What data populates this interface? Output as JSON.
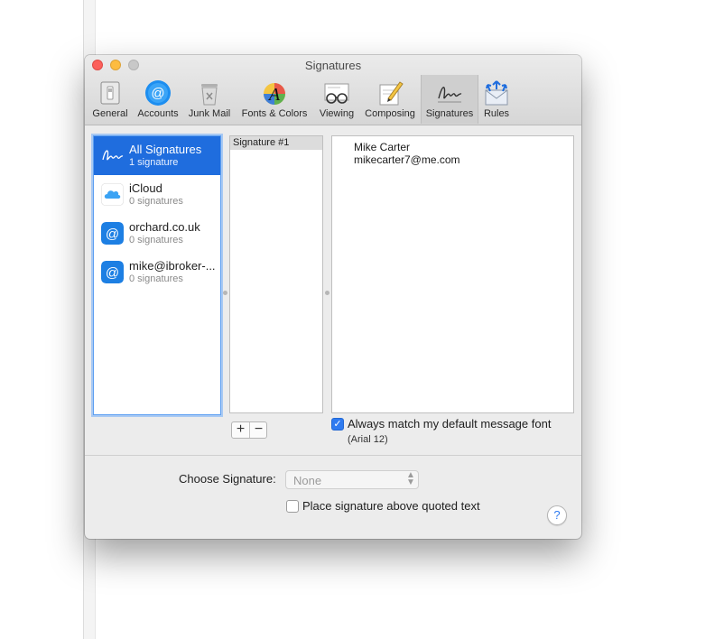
{
  "window": {
    "title": "Signatures"
  },
  "toolbar": {
    "items": [
      {
        "label": "General",
        "icon": "general-icon"
      },
      {
        "label": "Accounts",
        "icon": "accounts-icon"
      },
      {
        "label": "Junk Mail",
        "icon": "junk-mail-icon"
      },
      {
        "label": "Fonts & Colors",
        "icon": "fonts-colors-icon"
      },
      {
        "label": "Viewing",
        "icon": "viewing-icon"
      },
      {
        "label": "Composing",
        "icon": "composing-icon"
      },
      {
        "label": "Signatures",
        "icon": "signatures-icon",
        "selected": true
      },
      {
        "label": "Rules",
        "icon": "rules-icon"
      }
    ]
  },
  "accounts": [
    {
      "name": "All Signatures",
      "count": "1 signature",
      "icon": "signature-icon",
      "selected": true
    },
    {
      "name": "iCloud",
      "count": "0 signatures",
      "icon": "icloud-icon"
    },
    {
      "name": "orchard.co.uk",
      "count": "0 signatures",
      "icon": "at-sign-icon"
    },
    {
      "name": "mike@ibroker-...",
      "count": "0 signatures",
      "icon": "at-sign-icon"
    }
  ],
  "signatures": [
    {
      "name": "Signature #1",
      "selected": true
    }
  ],
  "preview": {
    "lines": [
      "Mike Carter",
      "mikecarter7@me.com"
    ]
  },
  "list_buttons": {
    "add": "+",
    "remove": "−"
  },
  "match_font": {
    "label": "Always match my default message font",
    "note": "(Arial 12)",
    "checked": true
  },
  "choose_signature": {
    "label": "Choose Signature:",
    "value": "None"
  },
  "place_above": {
    "label": "Place signature above quoted text",
    "checked": false
  },
  "help": {
    "label": "?"
  },
  "colors": {
    "accent": "#1f6dde",
    "checkbox": "#2f7bf0",
    "close": "#fc605b",
    "minimize": "#fdbc40"
  }
}
